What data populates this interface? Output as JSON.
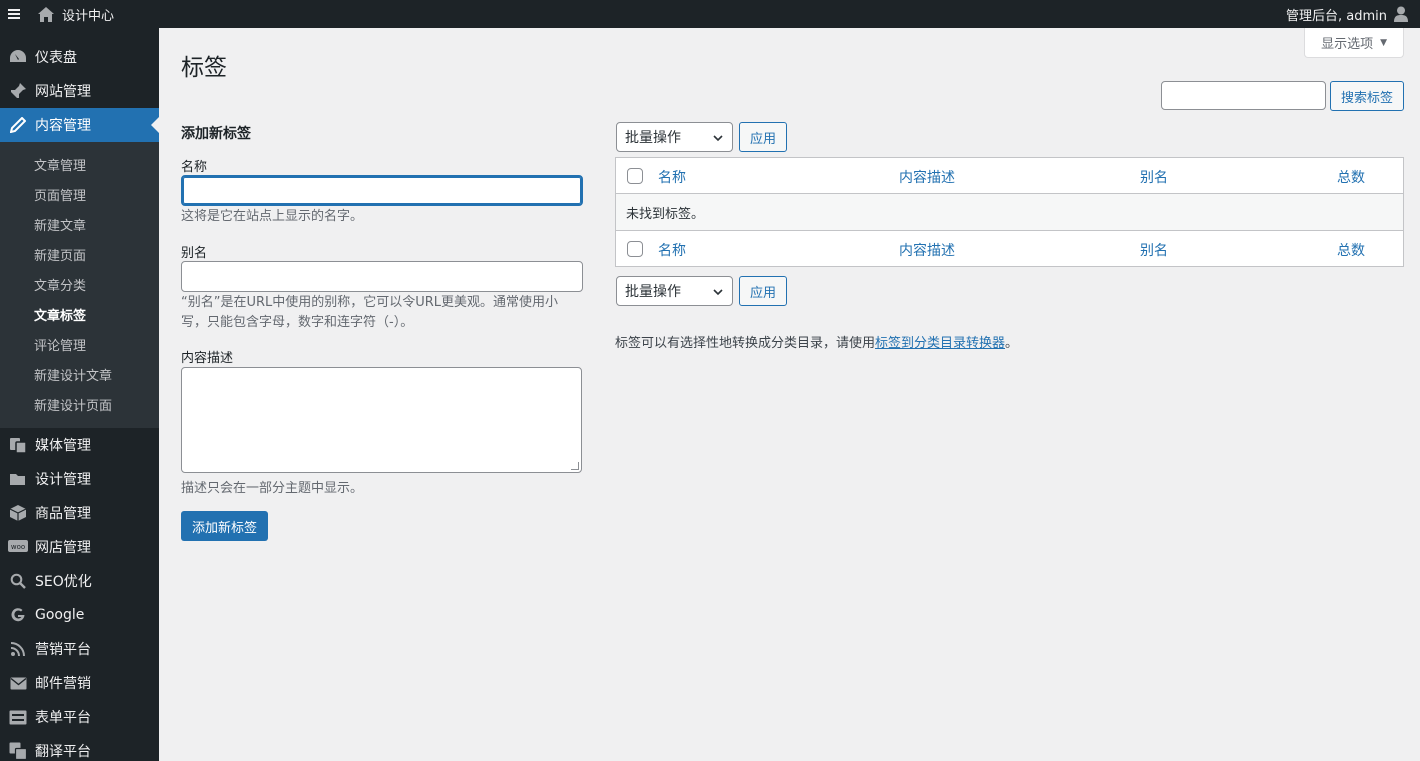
{
  "adminbar": {
    "site_name": "设计中心",
    "right_text": "管理后台, admin"
  },
  "sidebar": {
    "items": [
      {
        "label": "仪表盘",
        "icon": "dashboard-icon"
      },
      {
        "label": "网站管理",
        "icon": "pin-icon"
      },
      {
        "label": "内容管理",
        "icon": "edit-icon",
        "current": true
      },
      {
        "label": "媒体管理",
        "icon": "media-icon"
      },
      {
        "label": "设计管理",
        "icon": "folder-icon"
      },
      {
        "label": "商品管理",
        "icon": "box-icon"
      },
      {
        "label": "网店管理",
        "icon": "woo-icon"
      },
      {
        "label": "SEO优化",
        "icon": "search-icon"
      },
      {
        "label": "Google",
        "icon": "google-icon"
      },
      {
        "label": "营销平台",
        "icon": "rss-icon"
      },
      {
        "label": "邮件营销",
        "icon": "mail-icon"
      },
      {
        "label": "表单平台",
        "icon": "form-icon"
      },
      {
        "label": "翻译平台",
        "icon": "translate-icon"
      }
    ],
    "submenu": [
      "文章管理",
      "页面管理",
      "新建文章",
      "新建页面",
      "文章分类",
      "文章标签",
      "评论管理",
      "新建设计文章",
      "新建设计页面"
    ]
  },
  "page": {
    "title": "标签",
    "screen_options": "显示选项"
  },
  "search": {
    "value": "",
    "button": "搜索标签"
  },
  "form": {
    "heading": "添加新标签",
    "name_label": "名称",
    "name_value": "",
    "name_hint": "这将是它在站点上显示的名字。",
    "slug_label": "别名",
    "slug_value": "",
    "slug_hint_1": "“别名”是在URL中使用的别称，它可以令URL更美观。通常使用小",
    "slug_hint_2": "写，只能包含字母，数字和连字符（-）。",
    "desc_label": "内容描述",
    "desc_value": "",
    "desc_hint": "描述只会在一部分主题中显示。",
    "submit": "添加新标签"
  },
  "table": {
    "bulk_action": "批量操作",
    "apply": "应用",
    "columns": [
      "名称",
      "内容描述",
      "别名",
      "总数"
    ],
    "empty_text": "未找到标签。"
  },
  "note": {
    "text_before": "标签可以有选择性地转换成分类目录，请使用",
    "link": "标签到分类目录转换器",
    "text_after": "。"
  },
  "colors": {
    "accent": "#2271b1",
    "sidebar_bg": "#1d2327",
    "submenu_bg": "#2c3338",
    "page_bg": "#f0f0f1"
  }
}
